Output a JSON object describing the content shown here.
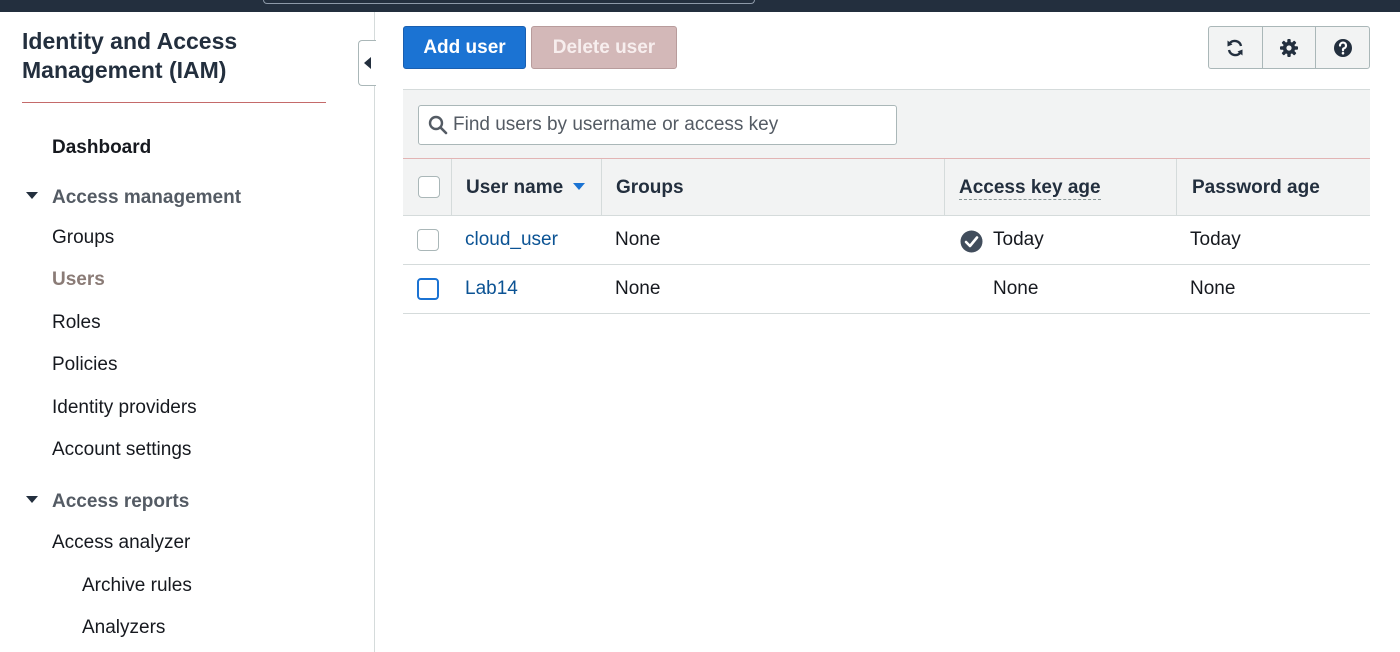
{
  "sidebar": {
    "title": "Identity and Access Management (IAM)",
    "dashboard": "Dashboard",
    "sections": [
      {
        "label": "Access management",
        "items": [
          "Groups",
          "Users",
          "Roles",
          "Policies",
          "Identity providers",
          "Account settings"
        ]
      },
      {
        "label": "Access reports",
        "items": [
          "Access analyzer",
          "Archive rules",
          "Analyzers"
        ]
      }
    ],
    "active_item": "Users"
  },
  "toolbar": {
    "add_user_label": "Add user",
    "delete_user_label": "Delete user",
    "icons": [
      "refresh-icon",
      "gear-icon",
      "help-icon"
    ]
  },
  "search": {
    "placeholder": "Find users by username or access key",
    "value": ""
  },
  "table": {
    "columns": [
      "User name",
      "Groups",
      "Access key age",
      "Password age"
    ],
    "sorted_column": "User name",
    "rows": [
      {
        "user_name": "cloud_user",
        "groups": "None",
        "access_key_age": "Today",
        "access_key_ok": true,
        "password_age": "Today"
      },
      {
        "user_name": "Lab14",
        "groups": "None",
        "access_key_age": "None",
        "access_key_ok": false,
        "password_age": "None"
      }
    ]
  },
  "colors": {
    "primary": "#1b73d3",
    "link": "#0b5394",
    "header_bg": "#232f3e",
    "disabled_button": "#d3b8b8"
  }
}
